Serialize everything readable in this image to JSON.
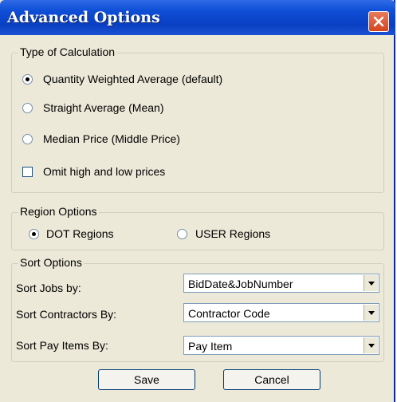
{
  "window": {
    "title": "Advanced Options"
  },
  "calculation": {
    "legend": "Type of Calculation",
    "options": [
      "Quantity Weighted Average (default)",
      "Straight Average (Mean)",
      "Median Price (Middle Price)"
    ],
    "selected": "Quantity Weighted Average (default)",
    "omit_label": "Omit high and low prices",
    "omit_checked": false
  },
  "region": {
    "legend": "Region Options",
    "dot_label": "DOT Regions",
    "user_label": "USER Regions",
    "selected": "DOT Regions"
  },
  "sort": {
    "legend": "Sort Options",
    "jobs_label": "Sort Jobs by:",
    "jobs_value": "BidDate&JobNumber",
    "contractors_label": "Sort Contractors By:",
    "contractors_value": "Contractor Code",
    "payitems_label": "Sort Pay Items By:",
    "payitems_value": "Pay Item"
  },
  "buttons": {
    "save": "Save",
    "cancel": "Cancel"
  }
}
